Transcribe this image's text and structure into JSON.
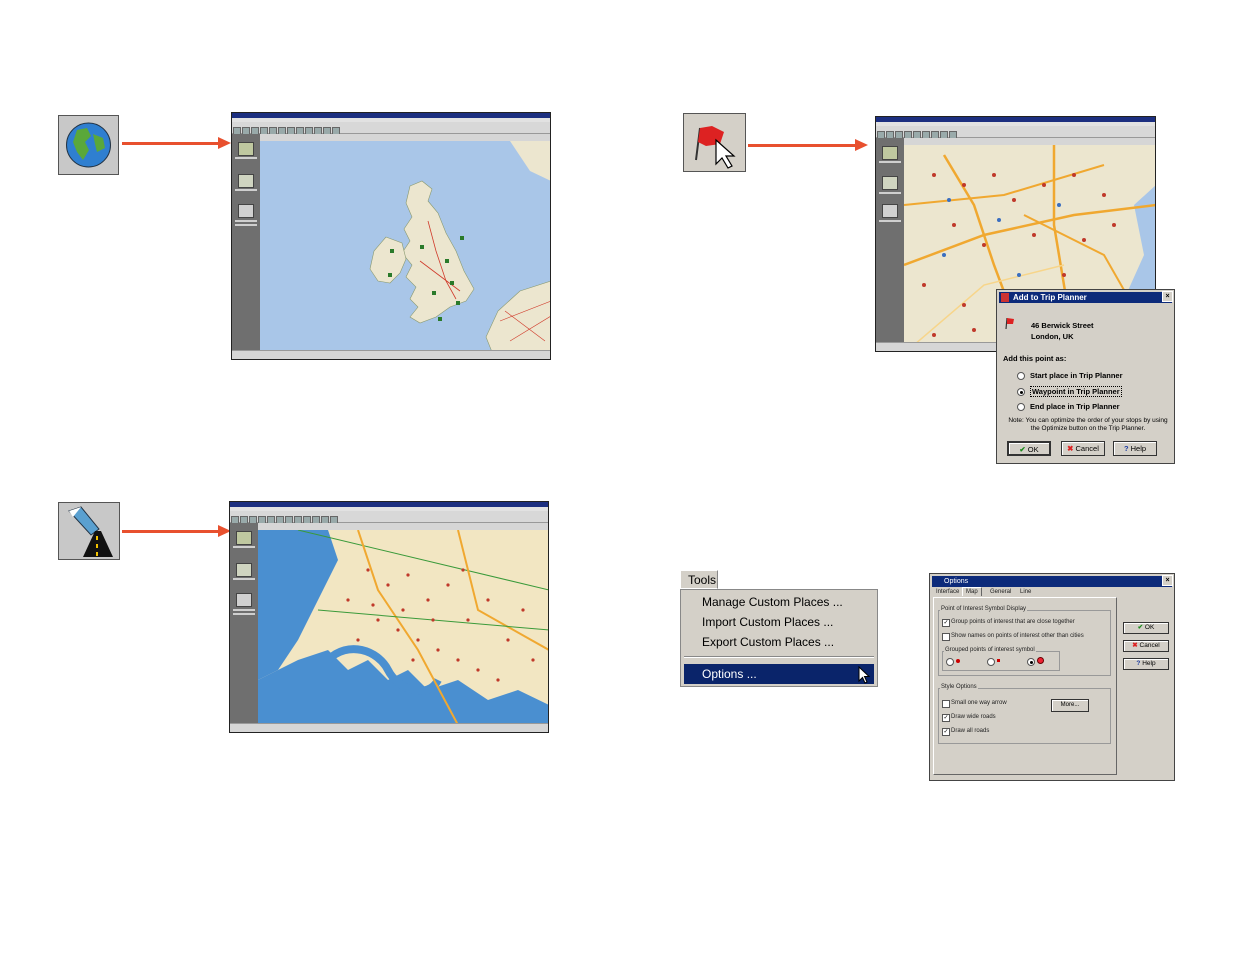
{
  "trip_dialog": {
    "title": "Add to Trip Planner",
    "close": "×",
    "address_line1": "46 Berwick Street",
    "address_line2": "London, UK",
    "prompt": "Add this point as:",
    "options": [
      {
        "label": "Start place in Trip Planner",
        "selected": false
      },
      {
        "label": "Waypoint in Trip Planner",
        "selected": true
      },
      {
        "label": "End place in Trip Planner",
        "selected": false
      }
    ],
    "note": "Note: You can optimize the order of your stops by using the Optimize button on the Trip Planner.",
    "ok": "OK",
    "cancel": "Cancel",
    "help": "Help"
  },
  "tools_menu": {
    "header": "Tools",
    "items": [
      "Manage Custom Places ...",
      "Import Custom Places ...",
      "Export Custom Places ...",
      "Options ..."
    ],
    "selected_index": 3
  },
  "options_dialog": {
    "title": "Options",
    "close": "×",
    "tabs": [
      "Interface",
      "Map",
      "General",
      "Line"
    ],
    "active_tab": "Map",
    "poi_group_label": "Point of Interest Symbol Display",
    "poi_checks": [
      {
        "label": "Group points of interest that are close together",
        "checked": true
      },
      {
        "label": "Show names on points of interest other than cities",
        "checked": false
      }
    ],
    "grouped_symbol_label": "Grouped points of interest symbol",
    "style_group_label": "Style Options",
    "style_checks": [
      {
        "label": "Small one way arrow",
        "checked": false
      },
      {
        "label": "Draw wide roads",
        "checked": true
      },
      {
        "label": "Draw all roads",
        "checked": true
      }
    ],
    "more_button": "More...",
    "ok": "OK",
    "cancel": "Cancel",
    "help": "Help"
  },
  "colors": {
    "arrow": "#e8502e",
    "sea": "#a9c6e8",
    "land": "#ece6cf",
    "menu_highlight": "#0a246a"
  },
  "icons": [
    "globe-icon",
    "flag-cursor-icon",
    "road-pen-icon"
  ]
}
